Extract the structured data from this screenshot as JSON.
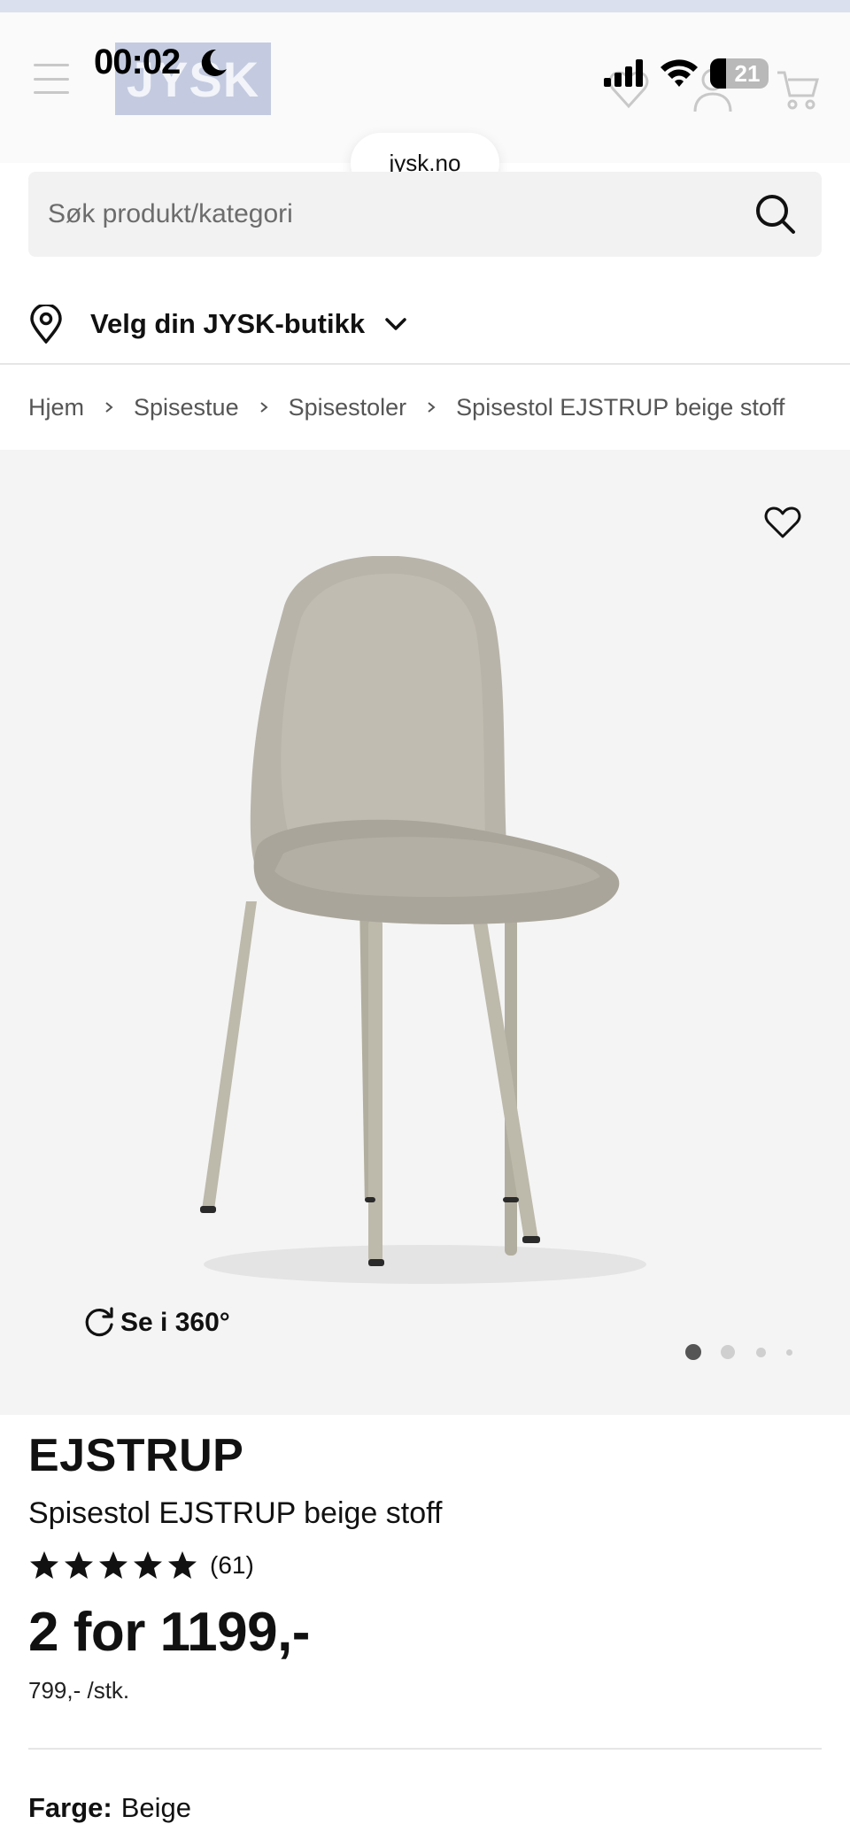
{
  "status_bar": {
    "time": "00:02",
    "battery": "21"
  },
  "header": {
    "logo": "JYSK",
    "url": "jysk.no"
  },
  "search": {
    "placeholder": "Søk produkt/kategori"
  },
  "store_selector": {
    "label": "Velg din JYSK-butikk"
  },
  "breadcrumb": [
    "Hjem",
    "Spisestue",
    "Spisestoler",
    "Spisestol EJSTRUP beige stoff"
  ],
  "gallery": {
    "spin_label": "Se i 360°",
    "active_slide": 1,
    "slide_count": 4
  },
  "product": {
    "brand": "EJSTRUP",
    "name": "Spisestol EJSTRUP beige stoff",
    "rating": 5,
    "review_count": "(61)",
    "price": "2 for 1199,-",
    "unit_price": "799,- /stk.",
    "color_label": "Farge:",
    "color_value": "Beige"
  },
  "colors": {
    "accent": "#dbe0ee",
    "logo_bg": "#c4cbe0",
    "gallery_bg": "#f4f4f4",
    "chair": "#b9b4aa"
  }
}
